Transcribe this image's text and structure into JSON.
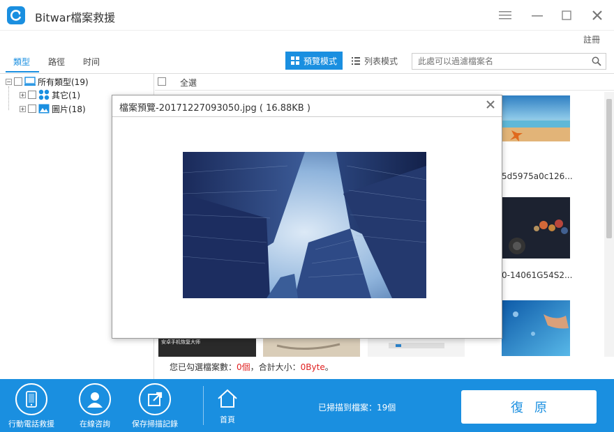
{
  "app": {
    "title": "Bitwar檔案救援"
  },
  "header": {
    "register_label": "註冊"
  },
  "tabs": [
    {
      "label": "類型",
      "active": true
    },
    {
      "label": "路徑",
      "active": false
    },
    {
      "label": "时间",
      "active": false
    }
  ],
  "toolbar": {
    "grid_view_label": "預覽模式",
    "list_view_label": "列表模式",
    "search_placeholder": "此處可以過濾檔案名"
  },
  "tree": {
    "root_label": "所有類型(19)",
    "children": [
      {
        "label": "其它(1)",
        "icon": "apps-icon"
      },
      {
        "label": "圖片(18)",
        "icon": "image-icon"
      }
    ]
  },
  "content": {
    "select_all_label": "全選",
    "thumbnails": [
      {
        "caption": "5d5975a0c126..."
      },
      {
        "caption": "0-14061G54S2..."
      },
      {
        "caption": ""
      },
      {
        "caption": ""
      },
      {
        "caption": ""
      },
      {
        "caption": ""
      },
      {
        "caption": "安卓手机恢复大师"
      }
    ],
    "status": {
      "prefix": "您已勾選檔案數：",
      "count": "0個",
      "middle": "，合計大小：",
      "size": "0Byte",
      "suffix": "。"
    }
  },
  "dialog": {
    "title": "檔案預覽-20171227093050.jpg ( 16.88KB )"
  },
  "bottom": {
    "items": [
      {
        "label": "行動電話救援",
        "icon": "phone-icon"
      },
      {
        "label": "在線咨詢",
        "icon": "user-support-icon"
      },
      {
        "label": "保存掃描記錄",
        "icon": "export-icon"
      },
      {
        "label": "首頁",
        "icon": "home-icon"
      }
    ],
    "scan_count": "已掃描到檔案：19個",
    "recover_label": "復原"
  },
  "colors": {
    "accent": "#1a8fe0",
    "warn": "#e02020"
  }
}
